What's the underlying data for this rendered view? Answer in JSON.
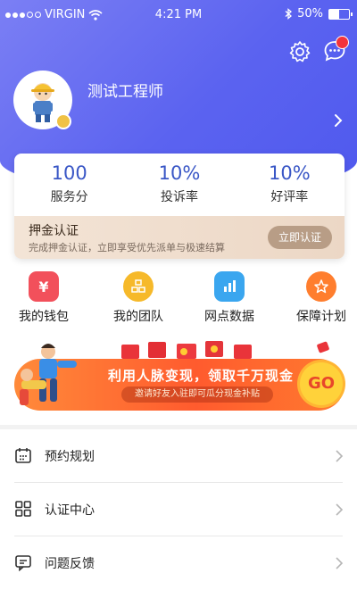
{
  "status_bar": {
    "carrier": "VIRGIN",
    "time": "4:21 PM",
    "battery": "50%"
  },
  "profile": {
    "name": "测试工程师"
  },
  "stats": [
    {
      "value": "100",
      "label": "服务分"
    },
    {
      "value": "10%",
      "label": "投诉率"
    },
    {
      "value": "10%",
      "label": "好评率"
    }
  ],
  "deposit": {
    "title": "押金认证",
    "desc": "完成押金认证，立即享受优先派单与极速结算",
    "button": "立即认证"
  },
  "quick_actions": [
    {
      "label": "我的钱包",
      "icon": "wallet-icon",
      "color": "#f2505b"
    },
    {
      "label": "我的团队",
      "icon": "team-icon",
      "color": "#f6b92a"
    },
    {
      "label": "网点数据",
      "icon": "data-chart-icon",
      "color": "#3aa6ef"
    },
    {
      "label": "保障计划",
      "icon": "star-shield-icon",
      "color": "#ff7e2e"
    }
  ],
  "banner": {
    "title": "利用人脉变现，领取千万现金",
    "subtitle": "邀请好友入驻即可瓜分现金补贴",
    "cta": "GO"
  },
  "menu": [
    {
      "label": "预约规划",
      "icon": "calendar-icon"
    },
    {
      "label": "认证中心",
      "icon": "grid-icon"
    },
    {
      "label": "问题反馈",
      "icon": "feedback-icon"
    }
  ],
  "colors": {
    "header": "#5b63f0",
    "accent": "#3a57c6"
  }
}
